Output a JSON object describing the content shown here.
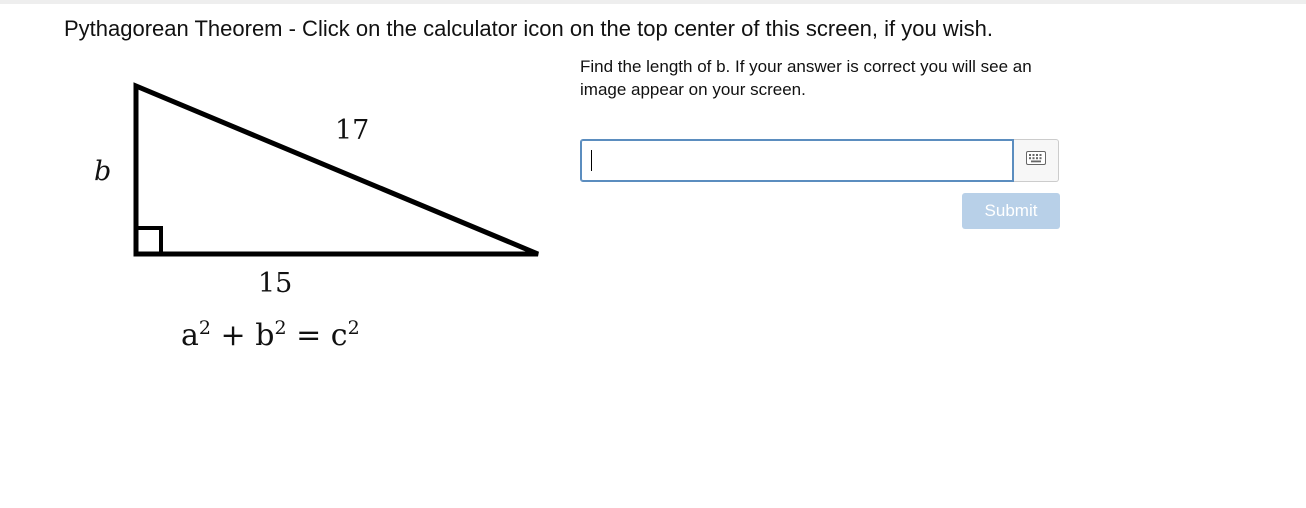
{
  "page": {
    "title": "Pythagorean Theorem - Click on the calculator icon on the top center of this screen, if you wish."
  },
  "figure": {
    "side_b_label": "b",
    "hypotenuse_label": "17",
    "base_label": "15",
    "formula": {
      "a": "a",
      "b": "b",
      "c": "c",
      "exp": "2",
      "plus": "+",
      "equals": "="
    }
  },
  "question": {
    "prompt": "Find the length of b. If your answer is correct you will see an image appear on your screen."
  },
  "answer": {
    "value": "",
    "placeholder": ""
  },
  "actions": {
    "submit_label": "Submit"
  },
  "icons": {
    "keyboard": "keyboard-icon"
  },
  "colors": {
    "input_border": "#5b8dbf",
    "submit_bg": "#b8d0e8"
  }
}
